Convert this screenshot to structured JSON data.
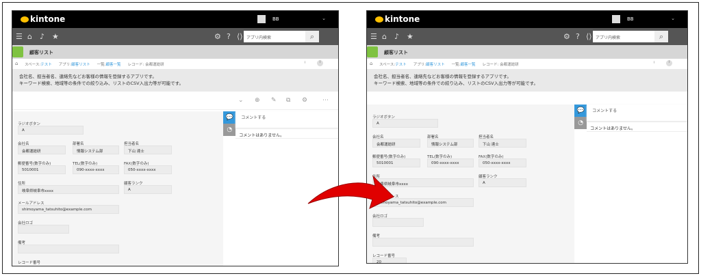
{
  "app": {
    "logo": "kintone",
    "user": "BB",
    "search_placeholder": "アプリ内検索",
    "title": "顧客リスト"
  },
  "breadcrumb": {
    "space_label": "スペース:",
    "space": "テスト",
    "app_label": "アプリ:",
    "app": "顧客リスト",
    "view_label": "一覧:",
    "view": "顧客一覧",
    "record": "レコード: 会都運総研"
  },
  "description": [
    "会社名、担当者名、連絡先などお客様の情報を登録するアプリです。",
    "キーワード検索、地域等の条件での絞り込み、リストのCSV入出力等が可能です。"
  ],
  "comments": {
    "post": "コメントする",
    "empty": "コメントはありません。"
  },
  "fields": [
    {
      "label": "ラジオボタン",
      "value": "A"
    },
    {
      "label": "会社名",
      "value": "会都運総研"
    },
    {
      "label": "部署名",
      "value": "情報システム部"
    },
    {
      "label": "担当者名",
      "value": "下山 達士"
    },
    {
      "label": "郵便番号(数字のみ)",
      "value": "5010001"
    },
    {
      "label": "TEL(数字のみ)",
      "value": "090-xxxx-xxxx"
    },
    {
      "label": "FAX(数字のみ)",
      "value": "050-xxxx-xxxx"
    },
    {
      "label": "住所",
      "value": "岐阜県岐阜市xxxx"
    },
    {
      "label": "顧客ランク",
      "value": "A"
    },
    {
      "label": "メールアドレス",
      "value": "shimoyama_tatsuhito@example.com"
    },
    {
      "label": "会社ロゴ",
      "value": ""
    },
    {
      "label": "備考",
      "value": ""
    },
    {
      "label": "レコード番号",
      "value": "20"
    }
  ],
  "colors": {
    "accent": "#3498db",
    "arrow": "#e00000",
    "app_icon": "#7fc241"
  }
}
